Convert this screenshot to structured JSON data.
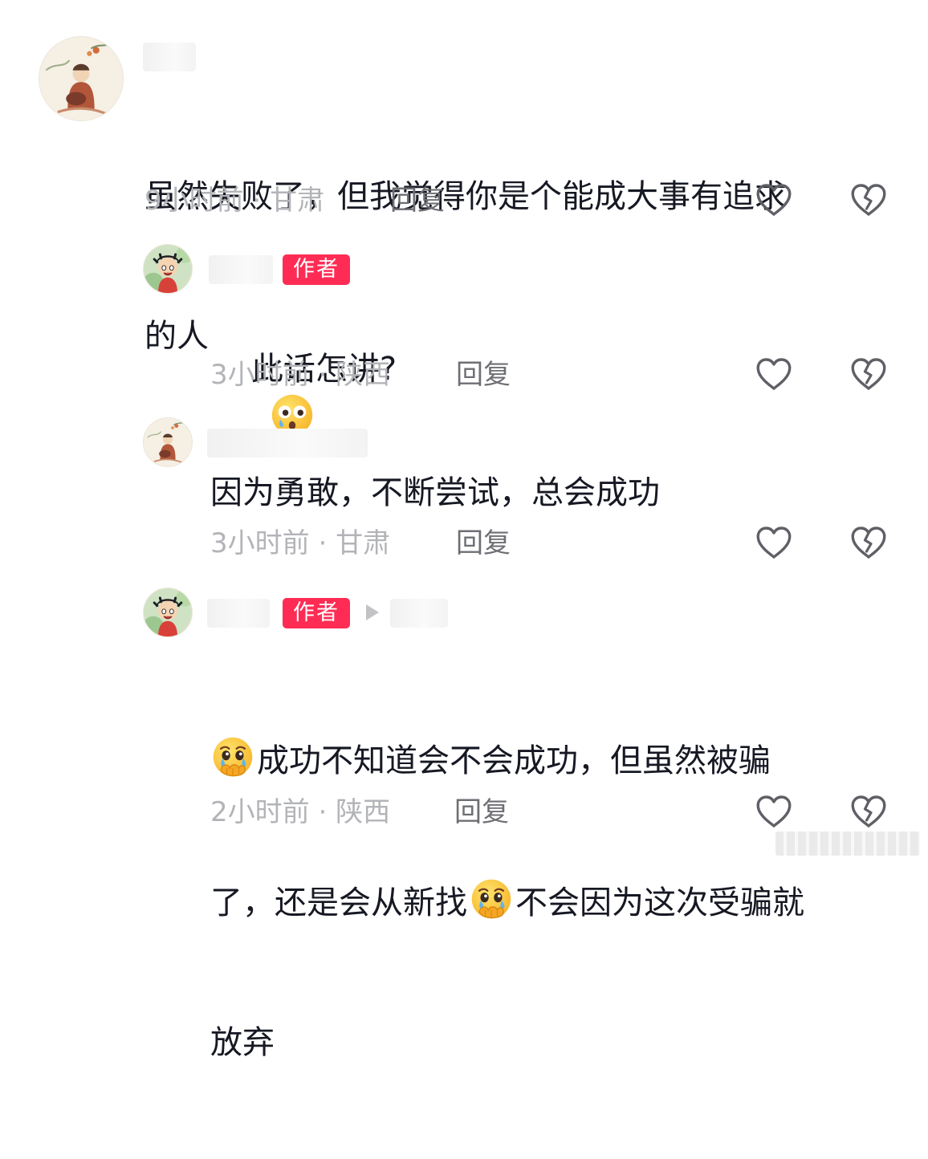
{
  "comments": [
    {
      "level": "top",
      "username": "",
      "text_lines": [
        "虽然失败了，但我觉得你是个能成大事有追求",
        "的人"
      ],
      "time": "9小时前",
      "location": "甘肃",
      "reply_label": "回复"
    },
    {
      "level": "reply",
      "username": "",
      "badge": "作者",
      "text": "此话怎讲?",
      "emoji": "astonished-tearful-emoji",
      "time": "3小时前",
      "location": "陕西",
      "reply_label": "回复"
    },
    {
      "level": "reply",
      "username": "",
      "text": "因为勇敢，不断尝试，总会成功",
      "time": "3小时前",
      "location": "甘肃",
      "reply_label": "回复"
    },
    {
      "level": "reply",
      "username": "",
      "badge": "作者",
      "reply_to": "",
      "line1": "成功不知道会不会成功，但虽然被骗",
      "line2a": "了，还是会从新找",
      "line2b": "不会因为这次受骗就",
      "line3": "放弃",
      "emoji": "holding-back-tears-emoji",
      "time": "2小时前",
      "location": "陕西",
      "reply_label": "回复"
    }
  ],
  "meta_separator": "·",
  "icons": {
    "like": "heart-outline-icon",
    "dislike": "broken-heart-icon"
  },
  "colors": {
    "badge": "#fe2c55",
    "text": "#161823",
    "meta": "#b3b4b8",
    "reply": "#6e6f74",
    "icon": "#5f6066"
  }
}
